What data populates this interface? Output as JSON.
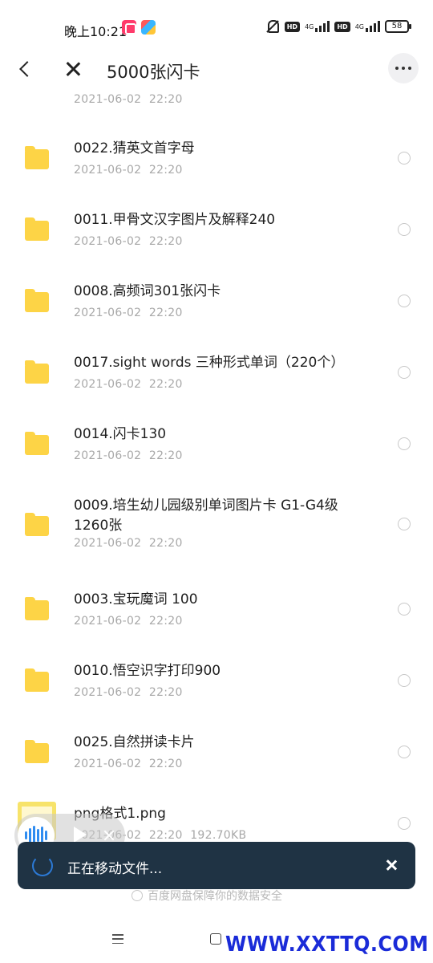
{
  "status_bar": {
    "time": "晚上10:21",
    "network_left": "4G",
    "network_right": "4G",
    "hd_label": "HD",
    "battery": "58",
    "icons": [
      "photo-app-icon",
      "video-app-icon",
      "mute-icon",
      "hd-icon",
      "signal-icon",
      "battery-icon"
    ]
  },
  "header": {
    "title": "5000张闪卡",
    "icons": [
      "back-icon",
      "close-icon",
      "more-icon"
    ]
  },
  "list": {
    "partial_top_meta": "2021-06-02  22:20",
    "items": [
      {
        "type": "folder",
        "name": "0022.猜英文首字母",
        "meta": "2021-06-02  22:20"
      },
      {
        "type": "folder",
        "name": "0011.甲骨文汉字图片及解释240",
        "meta": "2021-06-02  22:20"
      },
      {
        "type": "folder",
        "name": "0008.高频词301张闪卡",
        "meta": "2021-06-02  22:20"
      },
      {
        "type": "folder",
        "name": "0017.sight words 三种形式单词（220个）",
        "meta": "2021-06-02  22:20"
      },
      {
        "type": "folder",
        "name": "0014.闪卡130",
        "meta": "2021-06-02  22:20"
      },
      {
        "type": "folder",
        "name": "0009.培生幼儿园级别单词图片卡 G1-G4级 1260张",
        "meta": "2021-06-02  22:20"
      },
      {
        "type": "folder",
        "name": "0003.宝玩魔词 100",
        "meta": "2021-06-02  22:20"
      },
      {
        "type": "folder",
        "name": "0010.悟空识字打印900",
        "meta": "2021-06-02  22:20"
      },
      {
        "type": "folder",
        "name": "0025.自然拼读卡片",
        "meta": "2021-06-02  22:20"
      },
      {
        "type": "file",
        "name": "png格式1.png",
        "meta": "2021-06-02  22:20  192.70KB"
      }
    ]
  },
  "voice_pill": {
    "icons": [
      "voice-wave-icon",
      "play-icon",
      "close-icon"
    ]
  },
  "toast": {
    "text": "正在移动文件...",
    "icons": [
      "spinner-icon",
      "close-icon"
    ]
  },
  "footer": {
    "security_text": "百度网盘保障你的数据安全"
  },
  "nav_bar": {
    "icons": [
      "menu-icon",
      "home-icon"
    ]
  },
  "watermark": "WWW.XXTTQ.COM",
  "colors": {
    "folder": "#fdd446",
    "toast_bg": "#1f3344",
    "spinner": "#2c7ad6",
    "voice_accent": "#2f8cf0",
    "watermark": "#1a2bd8"
  }
}
